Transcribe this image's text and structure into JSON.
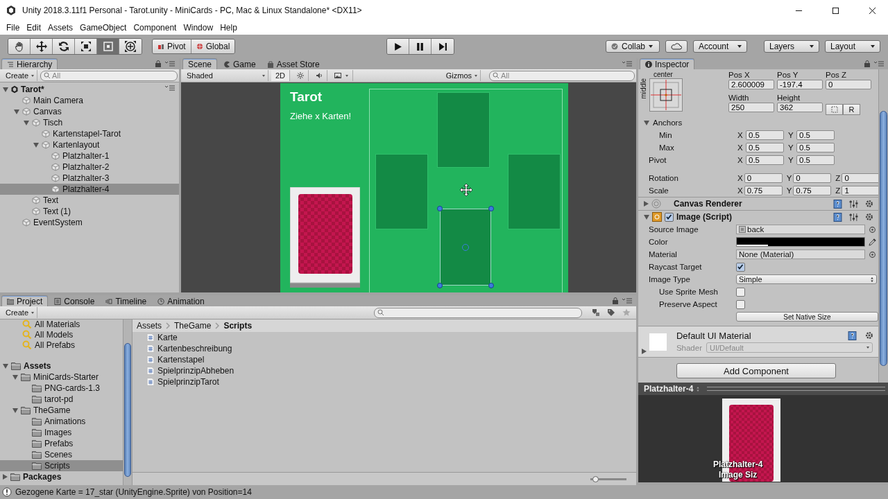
{
  "window": {
    "title": "Unity 2018.3.11f1 Personal - Tarot.unity - MiniCards - PC, Mac & Linux Standalone* <DX11>"
  },
  "menu": [
    "File",
    "Edit",
    "Assets",
    "GameObject",
    "Component",
    "Window",
    "Help"
  ],
  "toolbar": {
    "tools": [
      {
        "kind": "hand",
        "selected": false
      },
      {
        "kind": "move",
        "selected": false
      },
      {
        "kind": "rotate",
        "selected": false
      },
      {
        "kind": "scale",
        "selected": false
      },
      {
        "kind": "rect",
        "selected": true
      },
      {
        "kind": "transform",
        "selected": false
      }
    ],
    "pivot": "Pivot",
    "space": "Global",
    "playback": [
      {
        "kind": "play"
      },
      {
        "kind": "pause"
      },
      {
        "kind": "step"
      }
    ],
    "collab": "Collab",
    "account": "Account",
    "layers": "Layers",
    "layout": "Layout"
  },
  "hierarchy": {
    "title": "Hierarchy",
    "create": "Create",
    "search_placeholder": "All",
    "scene": "Tarot*",
    "items": [
      {
        "label": "Main Camera",
        "selected": false
      },
      {
        "label": "Canvas",
        "selected": false,
        "expanded": true,
        "children": [
          {
            "label": "Tisch",
            "selected": false,
            "expanded": true,
            "children": [
              {
                "label": "Kartenstapel-Tarot",
                "selected": false
              },
              {
                "label": "Kartenlayout",
                "selected": false,
                "expanded": true,
                "children": [
                  {
                    "label": "Platzhalter-1",
                    "selected": false
                  },
                  {
                    "label": "Platzhalter-2",
                    "selected": false
                  },
                  {
                    "label": "Platzhalter-3",
                    "selected": false
                  },
                  {
                    "label": "Platzhalter-4",
                    "selected": true
                  }
                ]
              }
            ]
          },
          {
            "label": "Text",
            "selected": false
          },
          {
            "label": "Text (1)",
            "selected": false
          }
        ]
      },
      {
        "label": "EventSystem",
        "selected": false
      }
    ]
  },
  "scene_view": {
    "tabs": [
      {
        "label": "Scene",
        "kind": "scene",
        "selected": true
      },
      {
        "label": "Game",
        "kind": "game",
        "selected": false
      },
      {
        "label": "Asset Store",
        "kind": "store",
        "selected": false
      }
    ],
    "shading": "Shaded",
    "mode_2d": {
      "label": "2D",
      "on": true
    },
    "gizmos": "Gizmos",
    "search_placeholder": "All",
    "canvas": {
      "title": "Tarot",
      "subtitle": "Ziehe x Karten!",
      "placeholders": [
        {
          "selected": false
        },
        {
          "selected": false
        },
        {
          "selected": false
        },
        {
          "selected": true
        }
      ]
    }
  },
  "inspector": {
    "title": "Inspector",
    "rect": {
      "anchor_h": "center",
      "anchor_v": "middle",
      "pos": [
        {
          "label": "Pos X",
          "value": "2.600009"
        },
        {
          "label": "Pos Y",
          "value": "-197.4"
        },
        {
          "label": "Pos Z",
          "value": "0"
        }
      ],
      "size": [
        {
          "label": "Width",
          "value": "250"
        },
        {
          "label": "Height",
          "value": "362"
        }
      ],
      "reset": "R"
    },
    "anchors": {
      "label": "Anchors",
      "expanded": true,
      "children": [
        {
          "label": "Min",
          "fields": [
            {
              "axis": "X",
              "value": "0.5"
            },
            {
              "axis": "Y",
              "value": "0.5"
            }
          ]
        },
        {
          "label": "Max",
          "fields": [
            {
              "axis": "X",
              "value": "0.5"
            },
            {
              "axis": "Y",
              "value": "0.5"
            }
          ]
        }
      ]
    },
    "rows": [
      {
        "label": "Pivot",
        "fields": [
          {
            "axis": "X",
            "value": "0.5"
          },
          {
            "axis": "Y",
            "value": "0.5"
          }
        ]
      },
      {
        "label": "Rotation",
        "fields": [
          {
            "axis": "X",
            "value": "0"
          },
          {
            "axis": "Y",
            "value": "0"
          },
          {
            "axis": "Z",
            "value": "0"
          }
        ]
      },
      {
        "label": "Scale",
        "fields": [
          {
            "axis": "X",
            "value": "0.75"
          },
          {
            "axis": "Y",
            "value": "0.75"
          },
          {
            "axis": "Z",
            "value": "1"
          }
        ]
      }
    ],
    "components": [
      {
        "name": "Canvas Renderer",
        "kind": "renderer",
        "expanded": false
      },
      {
        "name": "Image (Script)",
        "kind": "image",
        "expanded": true,
        "enabled": true
      }
    ],
    "image_props": [
      {
        "kind": "object",
        "label": "Source Image",
        "value": "back"
      },
      {
        "kind": "color",
        "label": "Color",
        "color": "#000000"
      },
      {
        "kind": "object",
        "label": "Material",
        "value": "None (Material)"
      },
      {
        "kind": "check",
        "label": "Raycast Target",
        "checked": true
      },
      {
        "kind": "dropdown",
        "label": "Image Type",
        "value": "Simple",
        "children": [
          {
            "kind": "check",
            "label": "Use Sprite Mesh",
            "checked": false
          },
          {
            "kind": "check",
            "label": "Preserve Aspect",
            "checked": false
          }
        ]
      }
    ],
    "native_size": "Set Native Size",
    "material": {
      "name": "Default UI Material",
      "shader_label": "Shader",
      "shader": "UI/Default"
    },
    "add_component": "Add Component"
  },
  "preview": {
    "title": "Platzhalter-4",
    "caption": "Platzhalter-4",
    "size_caption": "Image Siz"
  },
  "project": {
    "tabs": [
      {
        "label": "Project",
        "kind": "project",
        "selected": true
      },
      {
        "label": "Console",
        "kind": "console",
        "selected": false
      },
      {
        "label": "Timeline",
        "kind": "timeline",
        "selected": false
      },
      {
        "label": "Animation",
        "kind": "animation",
        "selected": false
      }
    ],
    "create": "Create",
    "favorites": [
      "All Materials",
      "All Models",
      "All Prefabs"
    ],
    "tree": [
      {
        "label": "Assets",
        "selected": false,
        "expanded": true,
        "children": [
          {
            "label": "MiniCards-Starter",
            "selected": false,
            "expanded": true,
            "children": [
              {
                "label": "PNG-cards-1.3",
                "selected": false
              },
              {
                "label": "tarot-pd",
                "selected": false
              }
            ]
          },
          {
            "label": "TheGame",
            "selected": false,
            "expanded": true,
            "children": [
              {
                "label": "Animations",
                "selected": false
              },
              {
                "label": "Images",
                "selected": false
              },
              {
                "label": "Prefabs",
                "selected": false
              },
              {
                "label": "Scenes",
                "selected": false
              },
              {
                "label": "Scripts",
                "selected": true
              }
            ]
          }
        ]
      },
      {
        "label": "Packages",
        "selected": false,
        "expanded": false
      }
    ],
    "breadcrumb": [
      "Assets",
      "TheGame",
      "Scripts"
    ],
    "files": [
      "Karte",
      "Kartenbeschreibung",
      "Kartenstapel",
      "SpielprinzipAbheben",
      "SpielprinzipTarot"
    ],
    "zoom": {
      "level": 0.05
    }
  },
  "status_bar": {
    "message": "Gezogene Karte = 17_star (UnityEngine.Sprite) von Position=14"
  }
}
